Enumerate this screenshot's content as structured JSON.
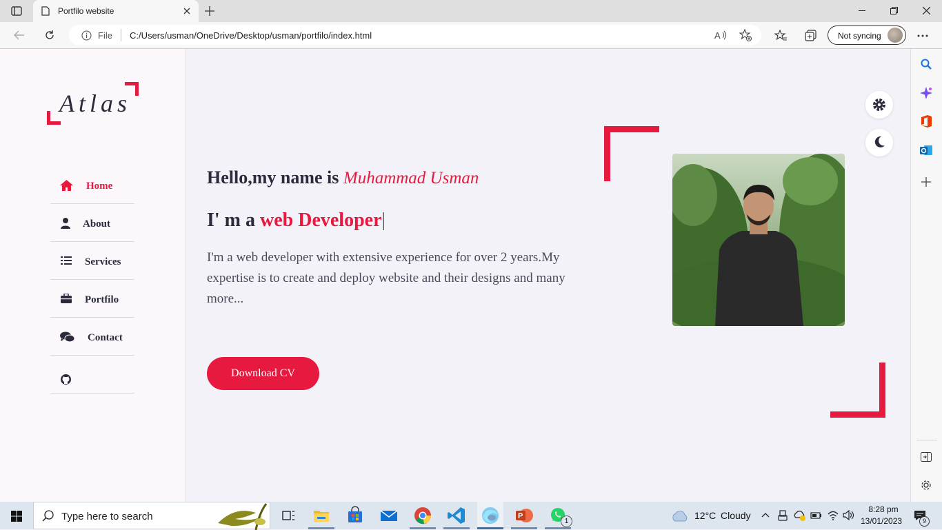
{
  "browser": {
    "tab_title": "Portfilo website",
    "address_scheme": "File",
    "url": "C:/Users/usman/OneDrive/Desktop/usman/portfilo/index.html",
    "sync_label": "Not syncing"
  },
  "site": {
    "logo_text": "Atlas",
    "nav": [
      {
        "label": "Home"
      },
      {
        "label": "About"
      },
      {
        "label": "Services"
      },
      {
        "label": "Portfilo"
      },
      {
        "label": "Contact"
      }
    ],
    "hero": {
      "greeting": "Hello,my name is",
      "name": "Muhammad Usman",
      "role_prefix": "I' m a",
      "role_typed": "web Developer",
      "cursor": "|",
      "description": "I'm a web developer with extensive experience for over 2 years.My expertise is to create and deploy website and their designs and many more...",
      "cta_label": "Download CV"
    },
    "accent_color": "#e8193f"
  },
  "taskbar": {
    "search_placeholder": "Type here to search",
    "weather_temp": "12°C",
    "weather_text": "Cloudy",
    "time": "8:28 pm",
    "date": "13/01/2023",
    "whatsapp_badge": "1",
    "notification_count": "9"
  }
}
